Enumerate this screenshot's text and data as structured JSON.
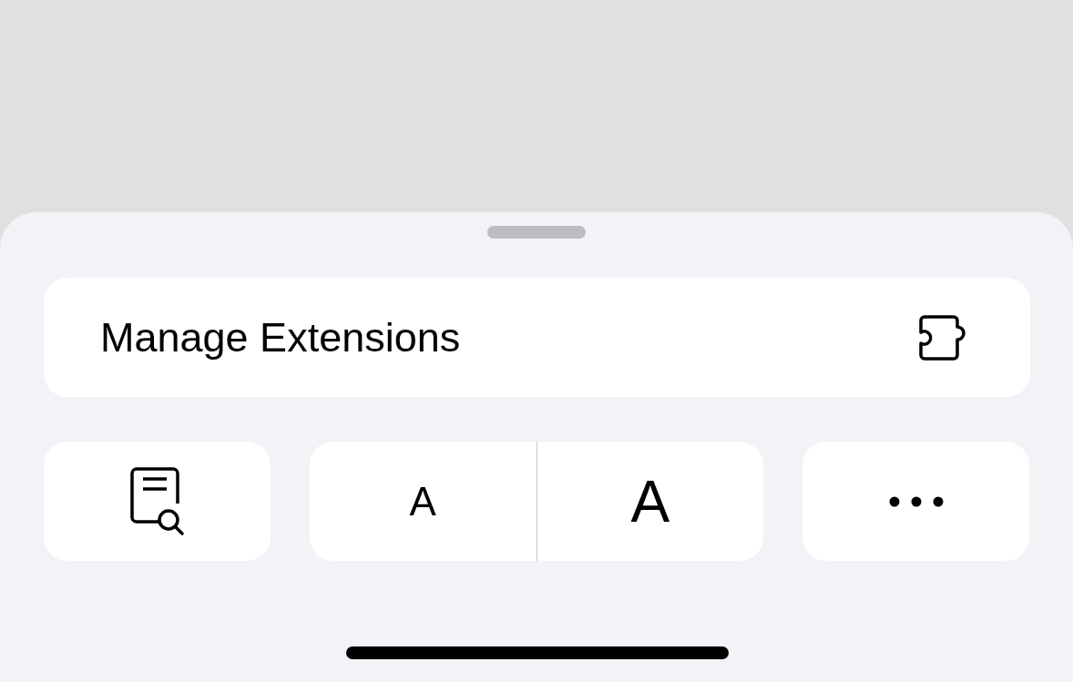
{
  "sheet": {
    "action": {
      "label": "Manage Extensions"
    },
    "toolbar": [
      {
        "kind": "reader"
      },
      {
        "kind": "text-size",
        "smaller_label": "A",
        "larger_label": "A"
      },
      {
        "kind": "more"
      }
    ]
  }
}
